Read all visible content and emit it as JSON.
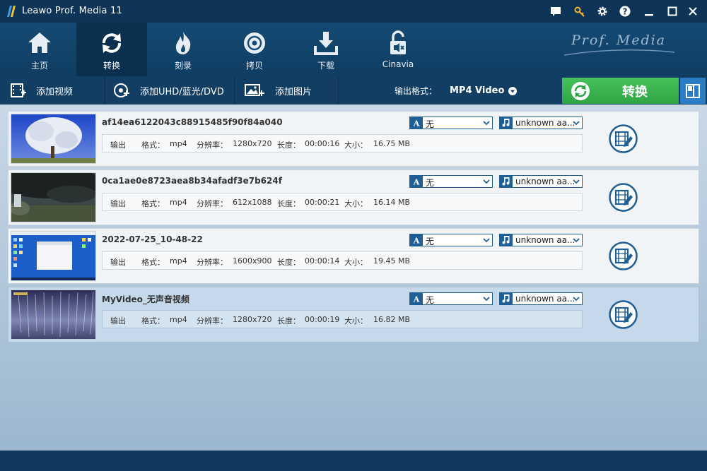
{
  "window": {
    "title": "Leawo Prof. Media 11",
    "icons": [
      "chat-icon",
      "key-icon",
      "gear-icon",
      "help-icon",
      "minimize-icon",
      "maximize-icon",
      "close-icon"
    ]
  },
  "nav": {
    "items": [
      {
        "label": "主页",
        "icon": "home-icon"
      },
      {
        "label": "转换",
        "icon": "convert-icon"
      },
      {
        "label": "刻录",
        "icon": "burn-icon"
      },
      {
        "label": "拷贝",
        "icon": "disc-copy-icon"
      },
      {
        "label": "下载",
        "icon": "download-icon"
      },
      {
        "label": "Cinavia",
        "icon": "cinavia-icon"
      }
    ],
    "active": "转换",
    "brand": "Prof. Media"
  },
  "toolbar": {
    "add_video": "添加视频",
    "add_uhd": "添加UHD/蓝光/DVD",
    "add_image": "添加图片",
    "format_label": "输出格式：",
    "format_value": "MP4 Video",
    "convert_label": "转换"
  },
  "colors": {
    "accent": "#2fa444",
    "navy": "#0f3a5e",
    "selected_row": "#c5d9ea"
  },
  "labels": {
    "output": "输出",
    "format": "格式：",
    "resolution": "分辨率：",
    "duration": "长度：",
    "size": "大小："
  },
  "files": [
    {
      "name": "af14ea6122043c88915485f90f84a040",
      "format": "mp4",
      "resolution": "1280x720",
      "duration": "00:00:16",
      "size": "16.75 MB",
      "subtitle": "无",
      "audio": "unknown aa...",
      "selected": false
    },
    {
      "name": "0ca1ae0e8723aea8b34afadf3e7b624f",
      "format": "mp4",
      "resolution": "612x1088",
      "duration": "00:00:21",
      "size": "16.14 MB",
      "subtitle": "无",
      "audio": "unknown aa...",
      "selected": false
    },
    {
      "name": "2022-07-25_10-48-22",
      "format": "mp4",
      "resolution": "1600x900",
      "duration": "00:00:14",
      "size": "19.45 MB",
      "subtitle": "无",
      "audio": "unknown aa...",
      "selected": false
    },
    {
      "name": "MyVideo_无声音视频",
      "format": "mp4",
      "resolution": "1280x720",
      "duration": "00:00:19",
      "size": "16.82 MB",
      "subtitle": "无",
      "audio": "unknown aa...",
      "selected": true
    }
  ]
}
